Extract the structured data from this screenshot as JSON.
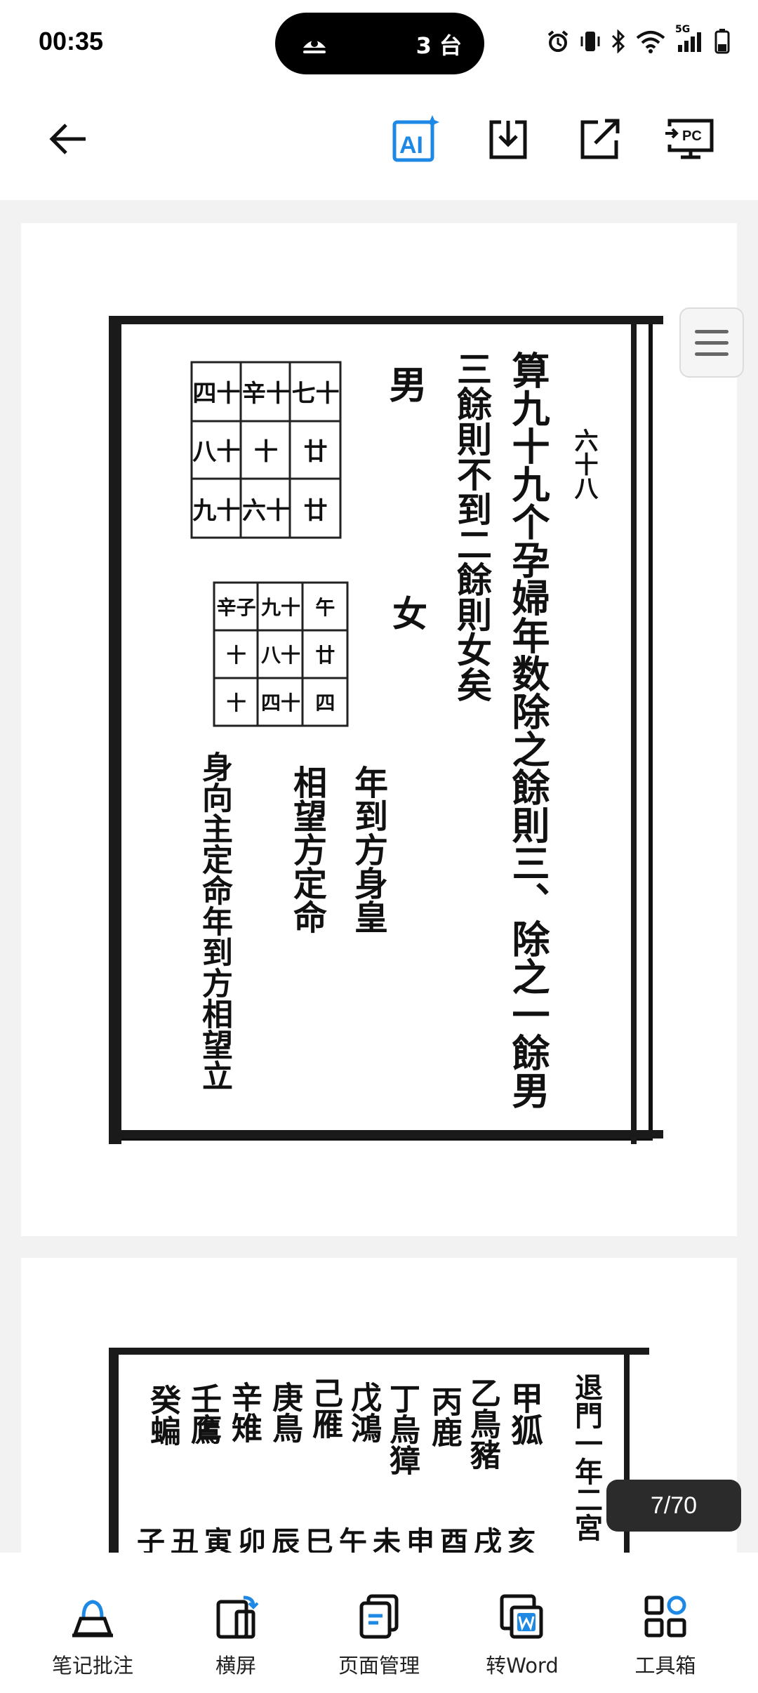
{
  "status_bar": {
    "time": "00:35",
    "island_devices": "3 台",
    "network_label": "5G"
  },
  "toolbar": {
    "icons": [
      "back-arrow-icon",
      "ai-icon",
      "download-icon",
      "share-icon",
      "pc-cast-icon"
    ],
    "ai_label": "AI",
    "pc_label": "PC",
    "accent_color": "#1e88e5"
  },
  "document": {
    "page_indicator": "7/70",
    "page1_text": {
      "page_number": "六十八",
      "line1": "算九十九个孕婦年数除之餘則三、除之一餘男",
      "line2": "三餘則不到二餘則女矣",
      "male": "男",
      "female": "女",
      "grid_male": [
        "七十",
        "廿",
        "廿",
        "辛十",
        "十",
        "六十",
        "九十",
        "八十",
        "四十"
      ],
      "grid_female": [
        "午",
        "廿",
        "四",
        "九十",
        "四十",
        "八十",
        "辛子",
        "十",
        "十"
      ],
      "note1": "年到方身皇",
      "note2": "相望方定命",
      "note3": "身向主定命年到方相望立"
    },
    "page2_text": {
      "col1": "甲狐",
      "col2": "乙鳥豬",
      "col3": "丙鹿",
      "col4": "丁烏獐",
      "col5": "戊鴻",
      "col6": "己雁",
      "col7": "庚鳥",
      "col8": "辛雉",
      "col9": "壬鷹",
      "col10": "癸蝙",
      "side": "退門一年二宮",
      "bottom_row": "亥戌酉申未午巳辰卯寅丑子"
    }
  },
  "bottom_bar": {
    "items": [
      {
        "label": "笔记批注",
        "icon": "pen-annotate-icon"
      },
      {
        "label": "横屏",
        "icon": "rotate-landscape-icon"
      },
      {
        "label": "页面管理",
        "icon": "page-manage-icon"
      },
      {
        "label": "转Word",
        "icon": "word-convert-icon"
      },
      {
        "label": "工具箱",
        "icon": "toolbox-icon"
      }
    ]
  }
}
